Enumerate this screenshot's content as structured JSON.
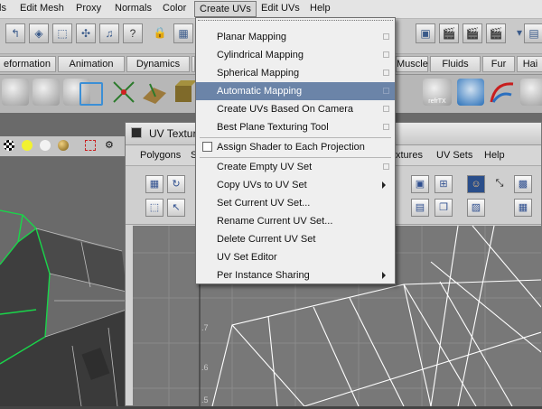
{
  "menubar": {
    "items": [
      "Edit Mesh",
      "Proxy",
      "Normals",
      "Color",
      "Create UVs",
      "Edit UVs",
      "Help"
    ],
    "first_partial": "ls",
    "active": "Create UVs"
  },
  "shelf_tabs": [
    "eformation",
    "Animation",
    "Dynamics",
    "Muscle",
    "Fluids",
    "Fur",
    "Hai"
  ],
  "shelf_icon_labels": {
    "refx": "refrTX"
  },
  "uv_editor": {
    "title": "UV Textur",
    "menus": [
      "Polygons",
      "S",
      "xtures",
      "UV Sets",
      "Help"
    ],
    "grid_labels": [
      ".7",
      ".6",
      ".5"
    ]
  },
  "dropdown": {
    "items": [
      {
        "label": "Planar Mapping",
        "option_box": true
      },
      {
        "label": "Cylindrical Mapping",
        "option_box": true
      },
      {
        "label": "Spherical Mapping",
        "option_box": true
      },
      {
        "label": "Automatic Mapping",
        "option_box": true,
        "highlighted": true
      },
      {
        "label": "Create UVs Based On Camera",
        "option_box": true
      },
      {
        "label": "Best Plane Texturing Tool",
        "option_box": true
      },
      {
        "label": "Assign Shader to Each Projection",
        "checkbox": true,
        "checked": false
      },
      {
        "label": "Create Empty UV Set",
        "option_box": true
      },
      {
        "label": "Copy UVs to UV Set",
        "submenu": true
      },
      {
        "label": "Set Current UV Set..."
      },
      {
        "label": "Rename Current UV Set..."
      },
      {
        "label": "Delete Current UV Set"
      },
      {
        "label": "UV Set Editor"
      },
      {
        "label": "Per Instance Sharing",
        "submenu": true
      }
    ]
  },
  "colors": {
    "highlight": "#6b84a8",
    "wireframe_green": "#19d64a",
    "uv_lines": "#ffffff",
    "menu_bg": "#efefef"
  }
}
